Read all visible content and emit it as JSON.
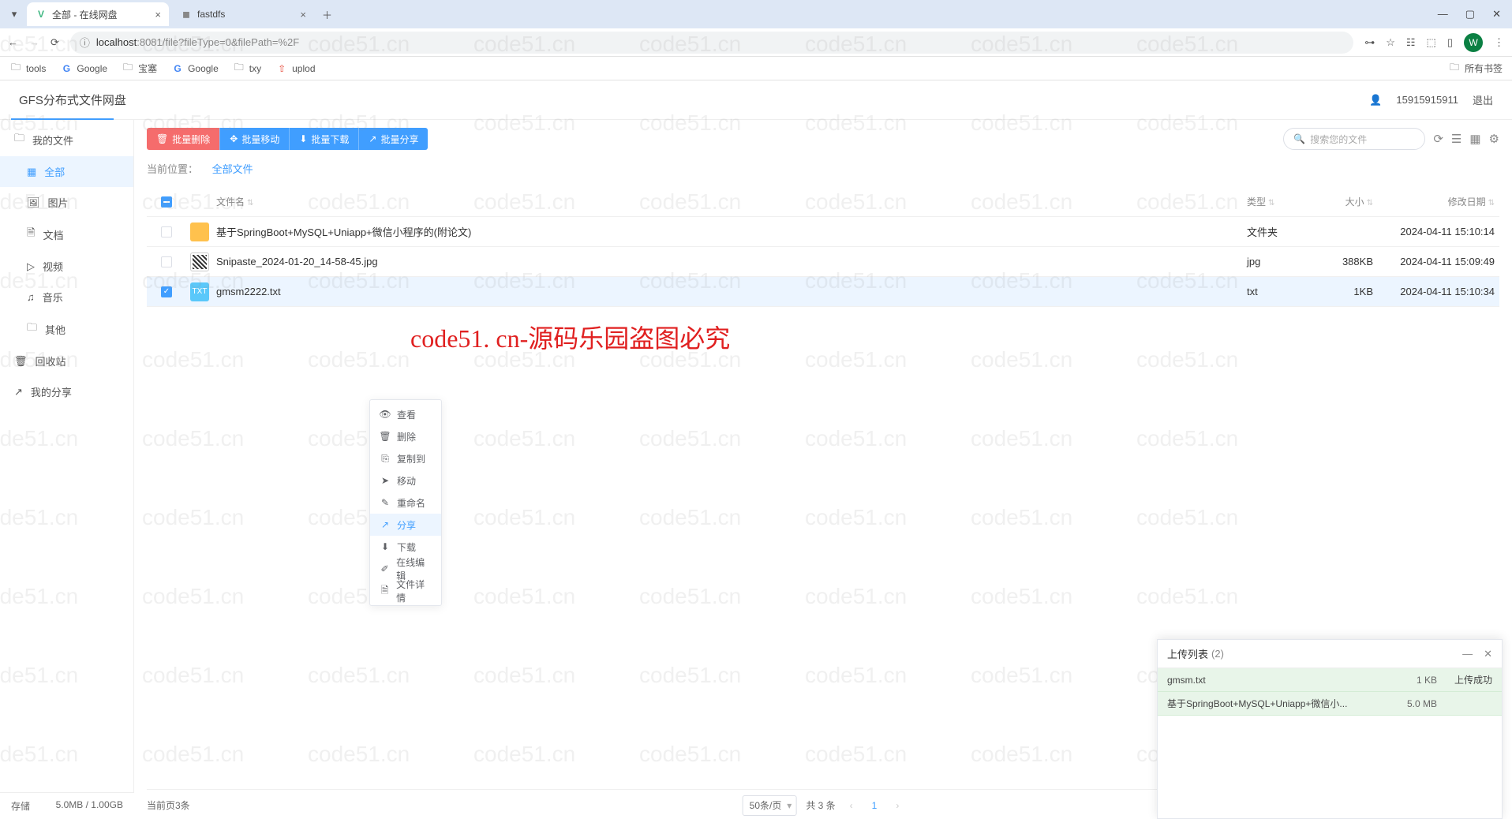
{
  "browser": {
    "tabs": [
      {
        "favicon": "V",
        "favicon_color": "#41b883",
        "title": "全部 - 在线网盘",
        "active": true
      },
      {
        "favicon": "◼",
        "favicon_color": "#888",
        "title": "fastdfs",
        "active": false
      }
    ],
    "url_host": "localhost",
    "url_port": ":8081",
    "url_path": "/file?fileType=0&filePath=%2F",
    "avatar_letter": "W",
    "bookmarks": [
      {
        "icon": "📁",
        "label": "tools"
      },
      {
        "icon": "G",
        "label": "Google"
      },
      {
        "icon": "📁",
        "label": "宝塞"
      },
      {
        "icon": "G",
        "label": "Google"
      },
      {
        "icon": "📁",
        "label": "txy"
      },
      {
        "icon": "⇧",
        "label": "uplod"
      }
    ],
    "bookmarks_right": {
      "icon": "📁",
      "label": "所有书签"
    }
  },
  "app": {
    "title": "GFS分布式文件网盘",
    "phone": "15915915911",
    "logout": "退出"
  },
  "sidebar": {
    "items": [
      {
        "icon": "🗀",
        "label": "我的文件",
        "type": "header"
      },
      {
        "icon": "▦",
        "label": "全部",
        "type": "sub",
        "active": true
      },
      {
        "icon": "🖼",
        "label": "图片",
        "type": "sub"
      },
      {
        "icon": "🗎",
        "label": "文档",
        "type": "sub"
      },
      {
        "icon": "▷",
        "label": "视频",
        "type": "sub"
      },
      {
        "icon": "♫",
        "label": "音乐",
        "type": "sub"
      },
      {
        "icon": "🗀",
        "label": "其他",
        "type": "sub"
      },
      {
        "icon": "🗑",
        "label": "回收站",
        "type": "header"
      },
      {
        "icon": "↗",
        "label": "我的分享",
        "type": "header"
      }
    ],
    "storage_label": "存储",
    "storage_value": "5.0MB / 1.00GB"
  },
  "toolbar": {
    "buttons": [
      {
        "icon": "🗑",
        "label": "批量删除",
        "cls": "btn1"
      },
      {
        "icon": "✥",
        "label": "批量移动",
        "cls": "btn2"
      },
      {
        "icon": "⬇",
        "label": "批量下载",
        "cls": "btn3"
      },
      {
        "icon": "↗",
        "label": "批量分享",
        "cls": "btn4"
      }
    ],
    "search_placeholder": "搜索您的文件",
    "breadcrumb_label": "当前位置：",
    "breadcrumb_path": "全部文件"
  },
  "table": {
    "headers": {
      "name": "文件名",
      "type": "类型",
      "size": "大小",
      "date": "修改日期"
    },
    "rows": [
      {
        "checked": false,
        "icon": "folder",
        "name": "基于SpringBoot+MySQL+Uniapp+微信小程序的(附论文)",
        "type": "文件夹",
        "size": "",
        "date": "2024-04-11 15:10:14"
      },
      {
        "checked": false,
        "icon": "jpg",
        "name": "Snipaste_2024-01-20_14-58-45.jpg",
        "type": "jpg",
        "size": "388KB",
        "date": "2024-04-11 15:09:49"
      },
      {
        "checked": true,
        "icon": "txt",
        "name": "gmsm2222.txt",
        "type": "txt",
        "size": "1KB",
        "date": "2024-04-11 15:10:34"
      }
    ]
  },
  "context_menu": {
    "items": [
      {
        "icon": "👁",
        "label": "查看"
      },
      {
        "icon": "🗑",
        "label": "删除"
      },
      {
        "icon": "⎘",
        "label": "复制到"
      },
      {
        "icon": "➤",
        "label": "移动"
      },
      {
        "icon": "✎",
        "label": "重命名"
      },
      {
        "icon": "↗",
        "label": "分享",
        "hover": true
      },
      {
        "icon": "⬇",
        "label": "下载"
      },
      {
        "icon": "✐",
        "label": "在线编辑"
      },
      {
        "icon": "🗎",
        "label": "文件详情"
      }
    ]
  },
  "upload": {
    "title": "上传列表",
    "count": "(2)",
    "rows": [
      {
        "name": "gmsm.txt",
        "size": "1 KB",
        "status": "上传成功"
      },
      {
        "name": "基于SpringBoot+MySQL+Uniapp+微信小...",
        "size": "5.0 MB",
        "status": ""
      }
    ]
  },
  "pager": {
    "left": "当前页3条",
    "per_page": "50条/页",
    "total": "共 3 条",
    "page": "1"
  },
  "center_text": "code51. cn-源码乐园盗图必究",
  "watermark": "code51.cn"
}
